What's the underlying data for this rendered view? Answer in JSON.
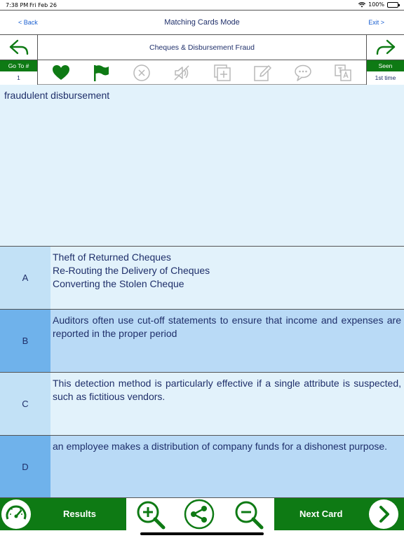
{
  "status_bar": {
    "time": "7:38 PM",
    "date": "Fri Feb 26",
    "battery": "100%",
    "icons": [
      "wifi-icon",
      "battery-icon"
    ]
  },
  "nav": {
    "back": "< Back",
    "title": "Matching Cards Mode",
    "exit": "Exit >"
  },
  "header": {
    "subject": "Cheques & Disbursement Fraud",
    "icons": [
      "back-arrow-icon",
      "forward-arrow-icon"
    ]
  },
  "toolbar": {
    "goto_label": "Go To #",
    "goto_value": "1",
    "seen_label": "Seen",
    "seen_value": "1st time",
    "icons": [
      "heart-icon",
      "flag-icon",
      "cancel-icon",
      "mute-icon",
      "add-card-icon",
      "edit-icon",
      "comment-icon",
      "translate-icon"
    ]
  },
  "question": {
    "text": "fraudulent disbursement"
  },
  "options": [
    {
      "letter": "A",
      "lines": [
        "Theft of Returned Cheques",
        "Re-Routing the Delivery of Cheques",
        "Converting the Stolen Cheque"
      ]
    },
    {
      "letter": "B",
      "text": "Auditors often use cut-off statements to ensure that income and expenses are reported in the proper period"
    },
    {
      "letter": "C",
      "text": "This detection method is particularly effective if a single attribute is suspected, such as fictitious vendors."
    },
    {
      "letter": "D",
      "text": "an employee makes a distribution of company funds for a dishonest purpose."
    }
  ],
  "bottom": {
    "results_label": "Results",
    "next_label": "Next Card",
    "icons": [
      "gauge-icon",
      "zoom-in-icon",
      "share-icon",
      "zoom-out-icon",
      "next-arrow-icon"
    ]
  },
  "colors": {
    "green": "#0e7a14",
    "text": "#1f2f6a",
    "link": "#1a5fd0",
    "light_blue": "#e2f2fb",
    "mid_blue": "#b9daf6",
    "dark_blue": "#6fb2eb"
  }
}
